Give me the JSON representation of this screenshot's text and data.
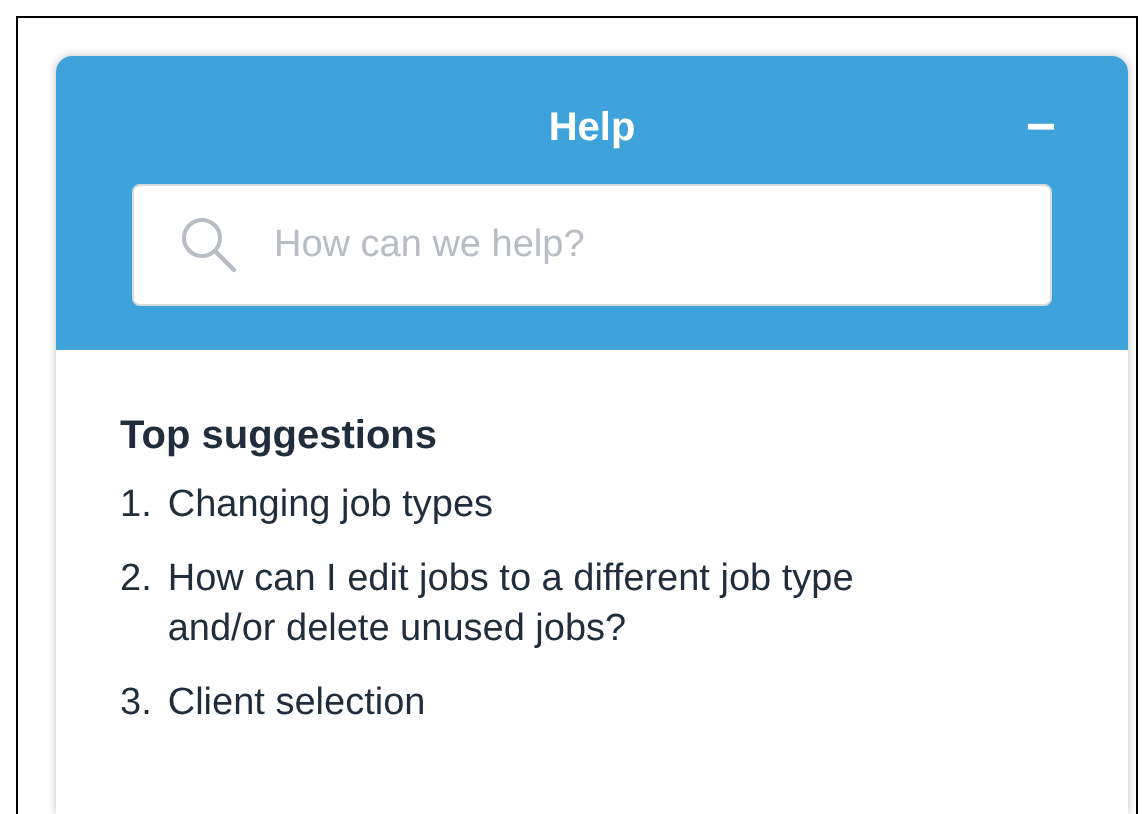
{
  "header": {
    "title": "Help",
    "minimize": "−"
  },
  "search": {
    "placeholder": "How can we help?"
  },
  "suggestions": {
    "heading": "Top suggestions",
    "items": [
      {
        "number": "1.",
        "text": "Changing job types"
      },
      {
        "number": "2.",
        "text": "How can I edit jobs to a different job type and/or delete unused jobs?"
      },
      {
        "number": "3.",
        "text": "Client selection"
      }
    ]
  }
}
